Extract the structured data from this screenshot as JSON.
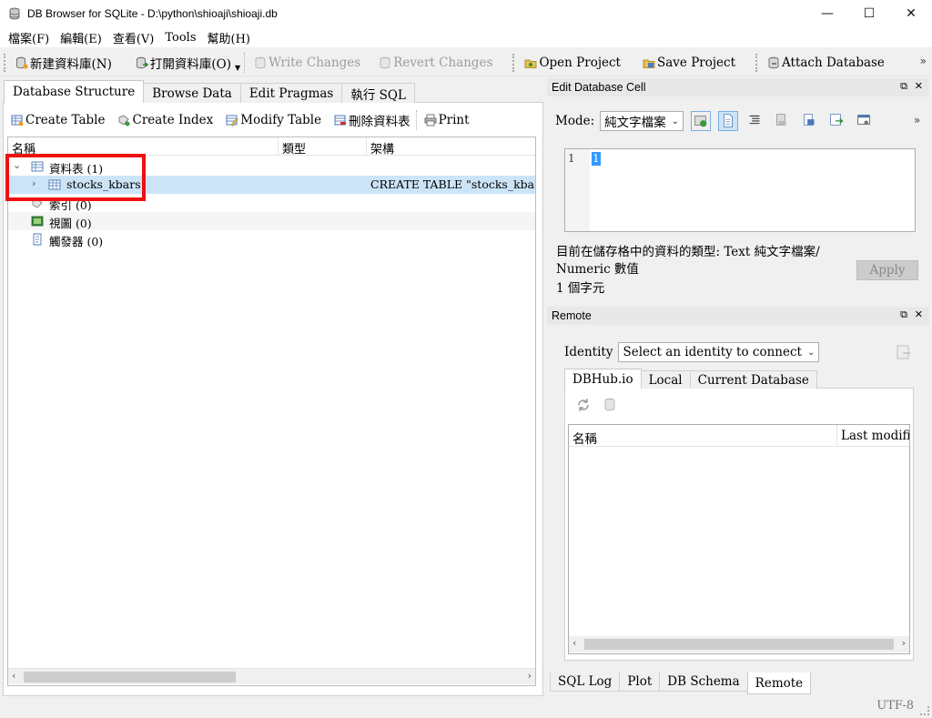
{
  "window": {
    "title": "DB Browser for SQLite - D:\\python\\shioaji\\shioaji.db",
    "minimize": "—",
    "maximize": "☐",
    "close": "✕"
  },
  "menu": [
    "檔案(F)",
    "編輯(E)",
    "查看(V)",
    "Tools",
    "幫助(H)"
  ],
  "toolbar": {
    "new_db": "新建資料庫(N)",
    "open_db": "打開資料庫(O)",
    "write_changes": "Write Changes",
    "revert_changes": "Revert Changes",
    "open_project": "Open Project",
    "save_project": "Save Project",
    "attach_db": "Attach Database",
    "overflow": "»"
  },
  "main_tabs": [
    "Database Structure",
    "Browse Data",
    "Edit Pragmas",
    "執行 SQL"
  ],
  "structure_toolbar": {
    "create_table": "Create Table",
    "create_index": "Create Index",
    "modify_table": "Modify Table",
    "delete_table": "刪除資料表",
    "print": "Print"
  },
  "tree": {
    "headers": [
      "名稱",
      "類型",
      "架構"
    ],
    "rows": [
      {
        "label": "資料表 (1)",
        "schema": ""
      },
      {
        "label": "stocks_kbars",
        "schema": "CREATE TABLE \"stocks_kbars\" ( \"ti"
      },
      {
        "label": "索引 (0)",
        "schema": ""
      },
      {
        "label": "視圖 (0)",
        "schema": ""
      },
      {
        "label": "觸發器 (0)",
        "schema": ""
      }
    ]
  },
  "edit_cell": {
    "title": "Edit Database Cell",
    "mode_label": "Mode:",
    "mode_value": "純文字檔案",
    "line_number": "1",
    "cell_value": "1",
    "type_info_1": "目前在儲存格中的資料的類型: Text 純文字檔案/",
    "type_info_2": "Numeric 數值",
    "char_count": "1 個字元",
    "apply": "Apply",
    "overflow": "»"
  },
  "remote": {
    "title": "Remote",
    "identity_label": "Identity",
    "identity_value": "Select an identity to connect",
    "tabs": [
      "DBHub.io",
      "Local",
      "Current Database"
    ],
    "list_headers": [
      "名稱",
      "Last modified"
    ]
  },
  "bottom_tabs": [
    "SQL Log",
    "Plot",
    "DB Schema",
    "Remote"
  ],
  "status": {
    "encoding": "UTF-8"
  },
  "colors": {
    "selection": "#cce4f7",
    "highlight_box": "#ee1111"
  }
}
